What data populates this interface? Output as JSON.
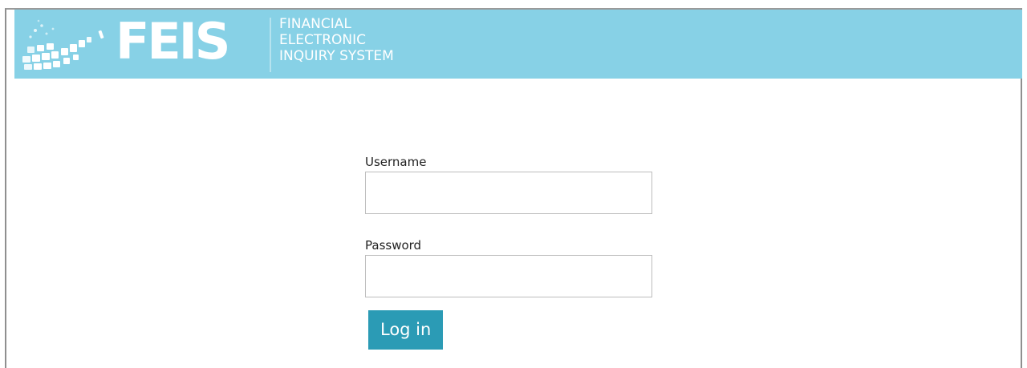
{
  "header": {
    "logo_text": "FEIS",
    "subtitle_lines": [
      "FINANCIAL",
      "ELECTRONIC",
      "INQUIRY SYSTEM"
    ],
    "background_color": "#87d1e6"
  },
  "login": {
    "username_label": "Username",
    "username_value": "",
    "password_label": "Password",
    "password_value": "",
    "submit_label": "Log in",
    "button_color": "#2b9bb5"
  }
}
